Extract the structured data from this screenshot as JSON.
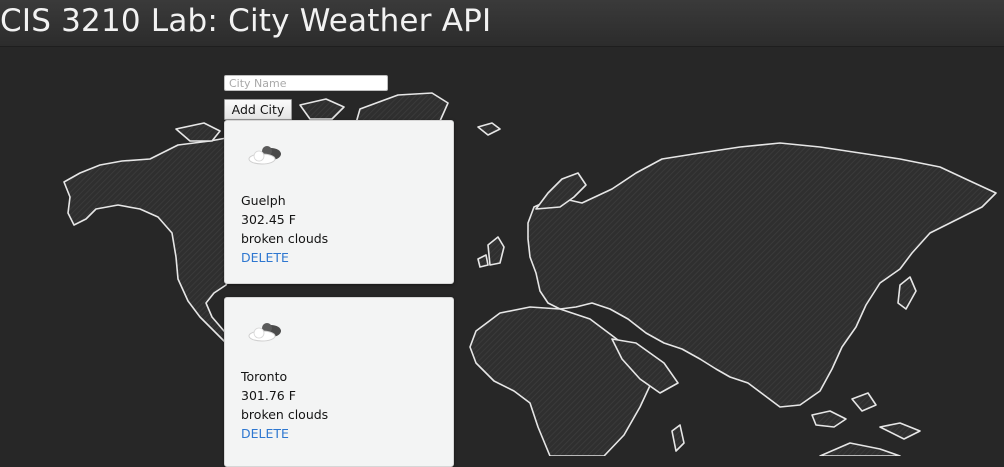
{
  "header": {
    "title": "CIS 3210 Lab: City Weather API"
  },
  "form": {
    "city_placeholder": "City Name",
    "city_value": "",
    "add_label": "Add City"
  },
  "cities": [
    {
      "name": "Guelph",
      "temperature": "302.45 F",
      "description": "broken clouds",
      "delete_label": "DELETE",
      "icon": "broken-clouds-icon"
    },
    {
      "name": "Toronto",
      "temperature": "301.76 F",
      "description": "broken clouds",
      "delete_label": "DELETE",
      "icon": "broken-clouds-icon"
    }
  ],
  "colors": {
    "background": "#272727",
    "header": "#333333",
    "card": "#f3f4f4",
    "link": "#2e77d0",
    "map_outline": "#e6e6e6"
  }
}
